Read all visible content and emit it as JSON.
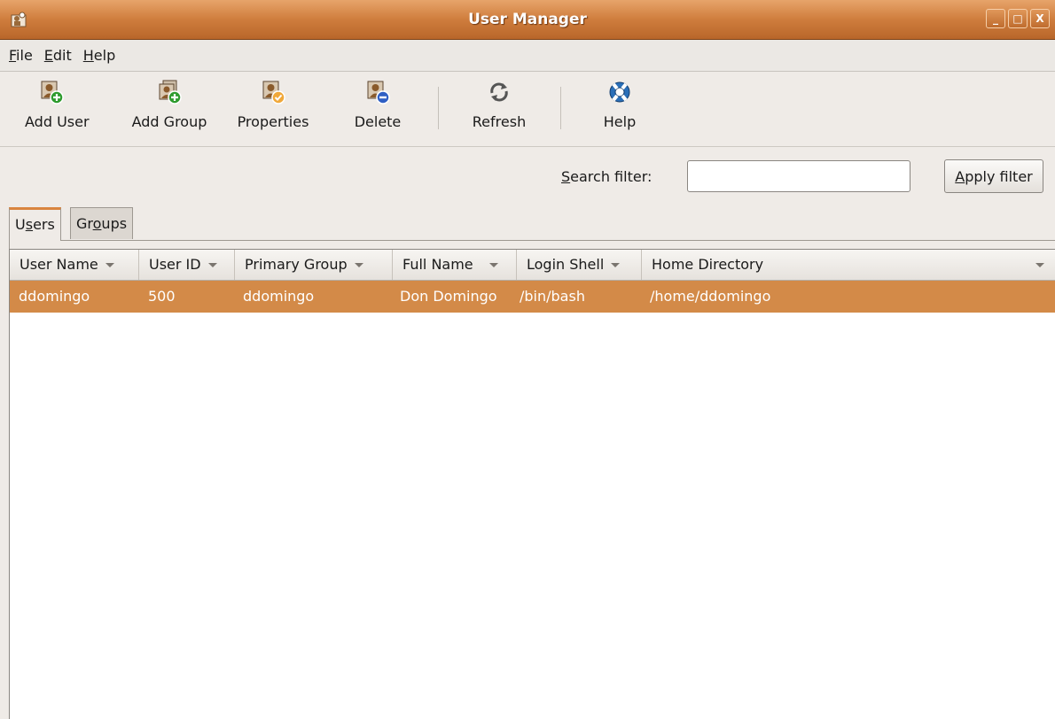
{
  "window": {
    "title": "User Manager",
    "buttons": [
      "_",
      "□",
      "X"
    ]
  },
  "menu": {
    "file": "File",
    "edit": "Edit",
    "help": "Help"
  },
  "toolbar": {
    "add_user": "Add User",
    "add_group": "Add Group",
    "properties": "Properties",
    "delete": "Delete",
    "refresh": "Refresh",
    "help": "Help"
  },
  "filter": {
    "label": "Search filter:",
    "value": "",
    "apply": "Apply filter"
  },
  "tabs": {
    "users": "Users",
    "groups": "Groups",
    "active": "Users"
  },
  "table": {
    "headers": [
      "User Name",
      "User ID",
      "Primary Group",
      "Full Name",
      "Login Shell",
      "Home Directory"
    ],
    "rows": [
      {
        "user_name": "ddomingo",
        "user_id": "500",
        "primary_group": "ddomingo",
        "full_name": "Don Domingo",
        "login_shell": "/bin/bash",
        "home_directory": "/home/ddomingo",
        "selected": true
      }
    ]
  },
  "colors": {
    "accent": "#d38a48",
    "titlebar": "#cf7d3d",
    "add_badge": "#2e9b2e",
    "delete_badge": "#2f5fc4"
  },
  "icons": [
    "app-icon",
    "add-user-icon",
    "add-group-icon",
    "properties-icon",
    "delete-user-icon",
    "refresh-icon",
    "help-lifebuoy-icon"
  ]
}
